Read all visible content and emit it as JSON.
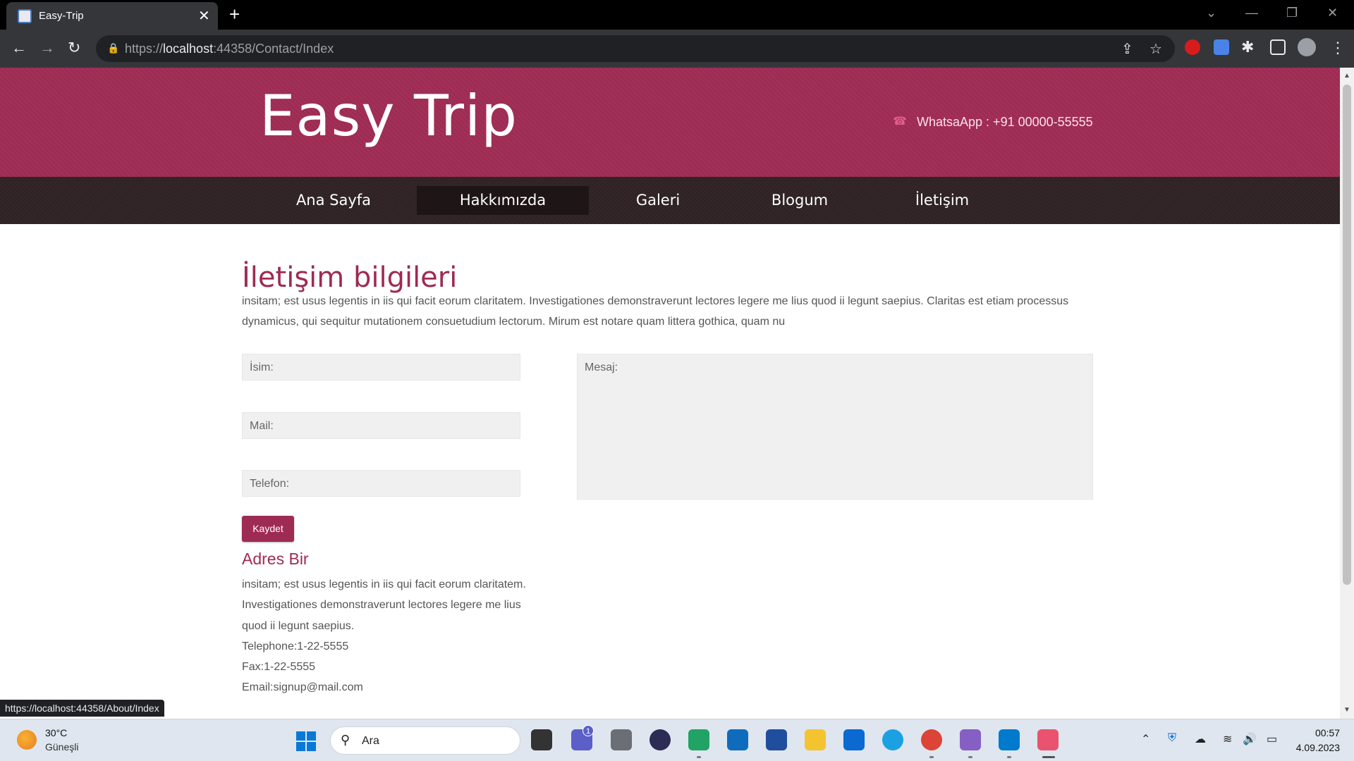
{
  "browser": {
    "tab_title": "Easy-Trip",
    "url_scheme": "https://",
    "url_host": "localhost",
    "url_path": ":44358/Contact/Index",
    "status_link": "https://localhost:44358/About/Index"
  },
  "site": {
    "logo": "Easy Trip",
    "whatsapp": "WhatsaApp : +91 00000-55555",
    "nav": [
      "Ana Sayfa",
      "Hakkımızda",
      "Galeri",
      "Blogum",
      "İletişim"
    ],
    "active_nav": "Hakkımızda"
  },
  "contact": {
    "title": "İletişim bilgileri",
    "intro": "insitam; est usus legentis in iis qui facit eorum claritatem. Investigationes demonstraverunt lectores legere me lius quod ii legunt saepius. Claritas est etiam processus dynamicus, qui sequitur mutationem consuetudium lectorum. Mirum est notare quam littera gothica, quam nu",
    "name_placeholder": "İsim:",
    "mail_placeholder": "Mail:",
    "phone_placeholder": "Telefon:",
    "message_placeholder": "Mesaj:",
    "submit_label": "Kaydet",
    "address_title": "Adres Bir",
    "address_text": "insitam; est usus legentis in iis qui facit eorum claritatem. Investigationes demonstraverunt lectores legere me lius quod ii legunt saepius.",
    "telephone": "Telephone:1-22-5555",
    "fax": "Fax:1-22-5555",
    "email": "Email:signup@mail.com"
  },
  "taskbar": {
    "temperature": "30°C",
    "weather": "Güneşli",
    "search_placeholder": "Ara",
    "chat_badge": "1",
    "time": "00:57",
    "date": "4.09.2023"
  },
  "colors": {
    "brand": "#9e2b53",
    "nav_bg": "#2e2224"
  }
}
